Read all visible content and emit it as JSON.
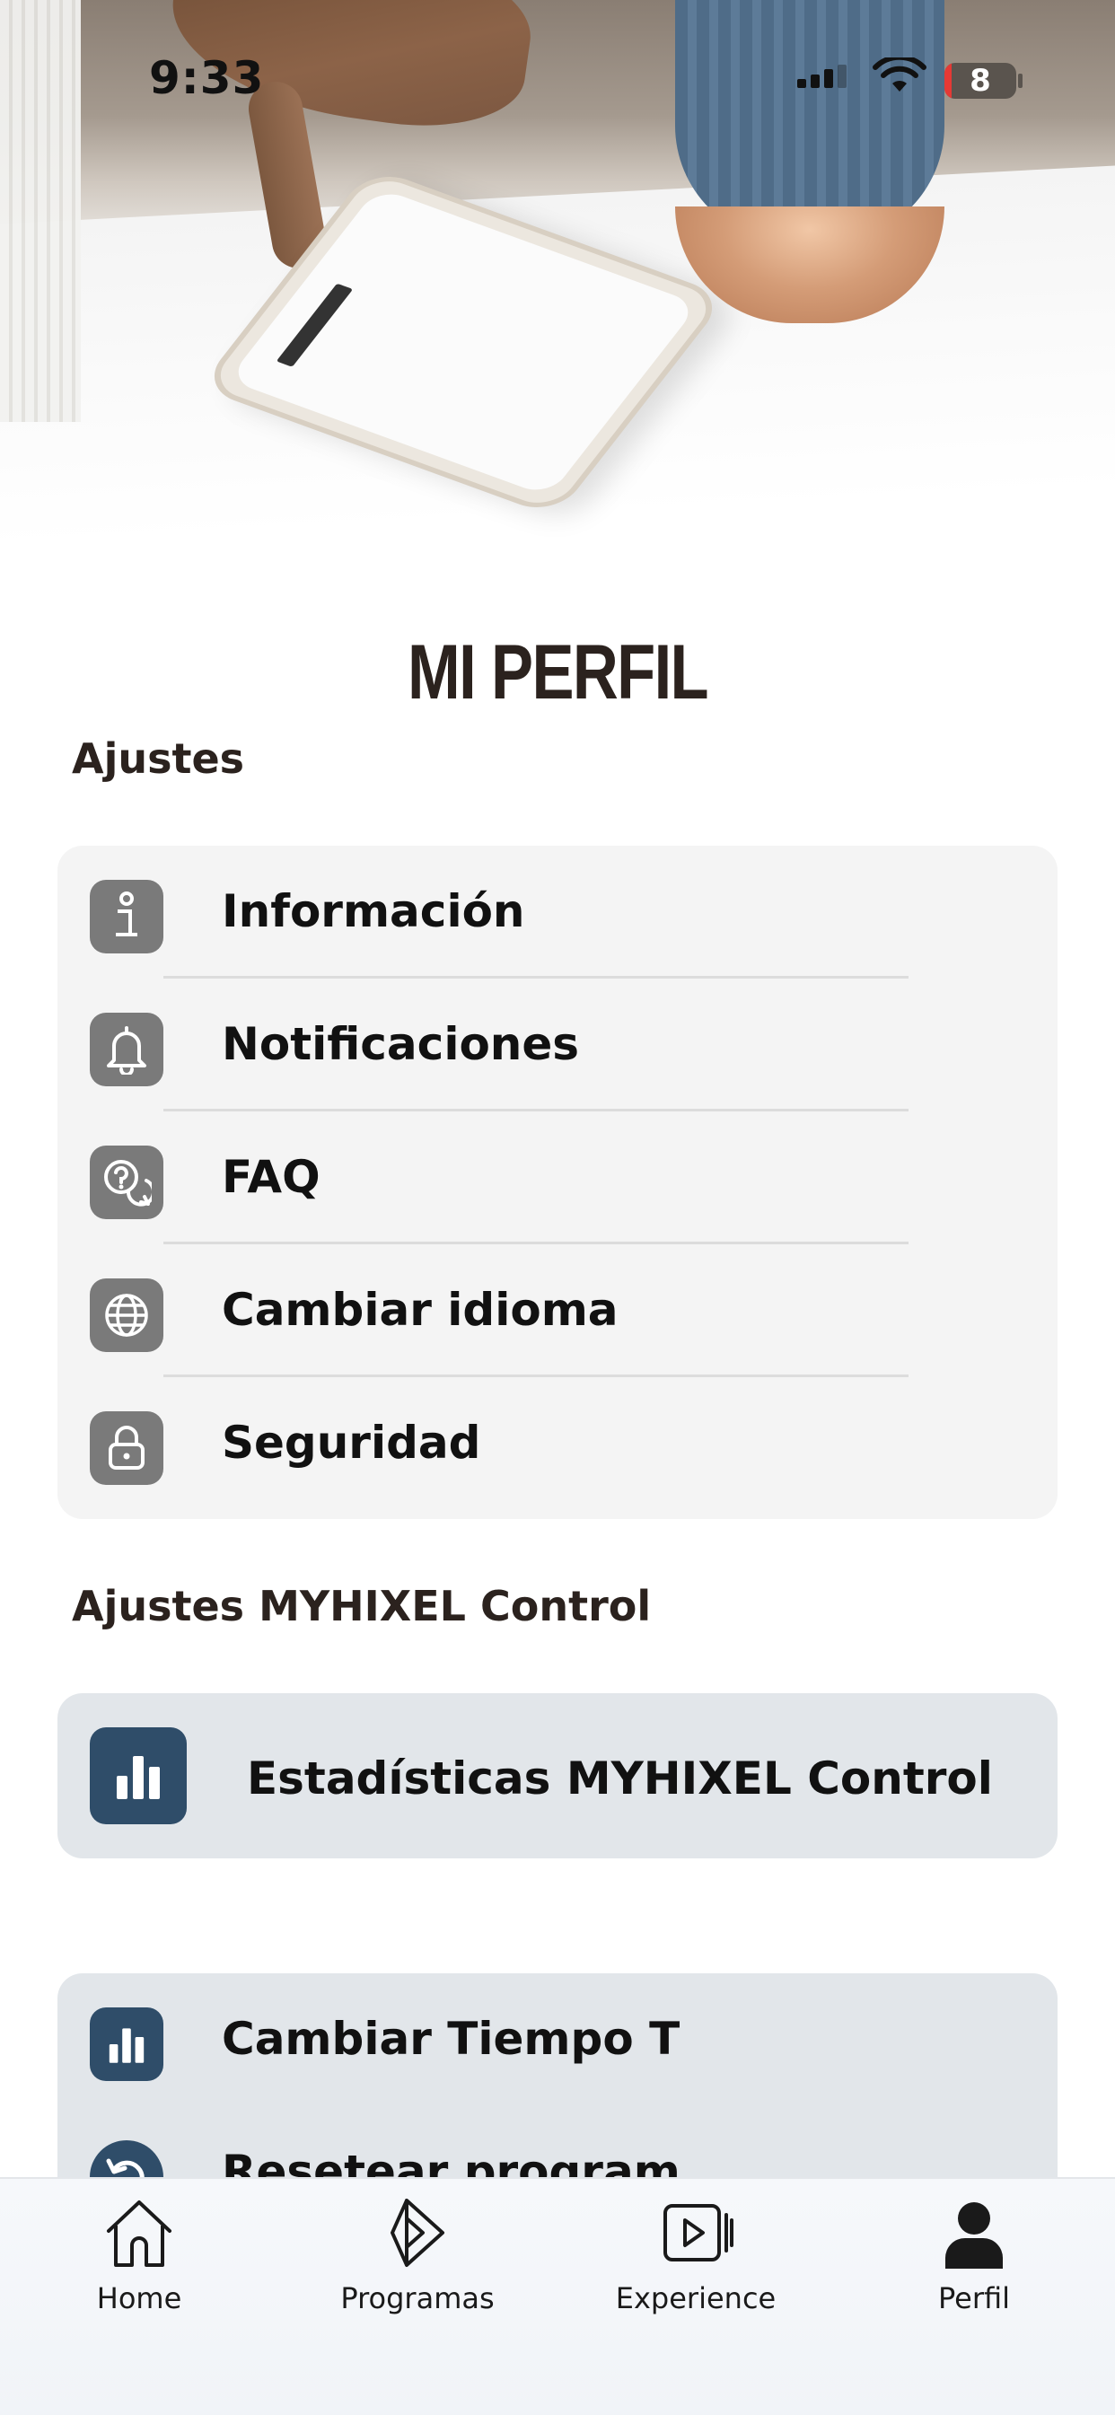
{
  "status_bar": {
    "time": "9:33",
    "battery_percent": "8",
    "battery_color": "#e53935"
  },
  "page": {
    "title": "MI PERFIL"
  },
  "settings": {
    "title": "Ajustes",
    "items": [
      {
        "label": "Información",
        "icon": "info-icon"
      },
      {
        "label": "Notificaciones",
        "icon": "bell-icon"
      },
      {
        "label": "FAQ",
        "icon": "faq-icon"
      },
      {
        "label": "Cambiar idioma",
        "icon": "globe-icon"
      },
      {
        "label": "Seguridad",
        "icon": "lock-icon"
      }
    ]
  },
  "control_settings": {
    "title": "Ajustes MYHIXEL Control",
    "stats_label": "Estadísticas MYHIXEL Control",
    "stats_icon": "bar-chart-icon"
  },
  "extra_settings": {
    "items": [
      {
        "label": "Cambiar Tiempo T",
        "icon": "bar-chart-icon"
      },
      {
        "label": "Resetear program",
        "icon": "reset-icon"
      }
    ]
  },
  "tab_bar": {
    "tabs": [
      {
        "label": "Home",
        "icon": "home-icon",
        "active": false
      },
      {
        "label": "Programas",
        "icon": "play-outline-icon",
        "active": false
      },
      {
        "label": "Experience",
        "icon": "video-icon",
        "active": false
      },
      {
        "label": "Perfil",
        "icon": "person-icon",
        "active": true
      }
    ]
  },
  "colors": {
    "accent_navy": "#2f4d69",
    "icon_gray": "#7a7a7a",
    "title_brown": "#2b221e"
  }
}
